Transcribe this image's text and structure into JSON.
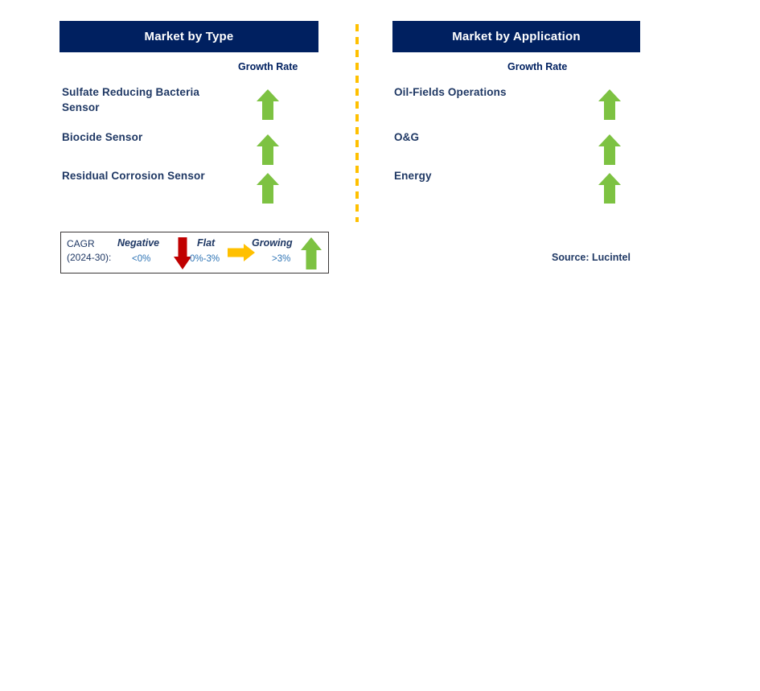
{
  "panels": [
    {
      "id": "market-by-type",
      "title": "Market by Type",
      "growth_rate_label": "Growth Rate",
      "rows": [
        {
          "label": "Sulfate Reducing Bacteria Sensor",
          "growth": "Growing",
          "icon": "arrow-up-green-icon"
        },
        {
          "label": "Biocide Sensor",
          "growth": "Growing",
          "icon": "arrow-up-green-icon"
        },
        {
          "label": "Residual Corrosion Sensor",
          "growth": "Growing",
          "icon": "arrow-up-green-icon"
        }
      ]
    },
    {
      "id": "market-by-application",
      "title": "Market by Application",
      "growth_rate_label": "Growth Rate",
      "rows": [
        {
          "label": "Oil-Fields Operations",
          "growth": "Growing",
          "icon": "arrow-up-green-icon"
        },
        {
          "label": "O&G",
          "growth": "Growing",
          "icon": "arrow-up-green-icon"
        },
        {
          "label": "Energy",
          "growth": "Growing",
          "icon": "arrow-up-green-icon"
        }
      ]
    }
  ],
  "legend": {
    "cagr_line1": "CAGR",
    "cagr_line2": "(2024-30):",
    "items": [
      {
        "term": "Negative",
        "range": "<0%",
        "icon": "arrow-down-red-icon"
      },
      {
        "term": "Flat",
        "range": "0%-3%",
        "icon": "arrow-right-orange-icon"
      },
      {
        "term": "Growing",
        "range": ">3%",
        "icon": "arrow-up-green-icon"
      }
    ]
  },
  "source": "Source: Lucintel",
  "colors": {
    "header_navy": "#002060",
    "label_navy": "#1F3864",
    "growing_green": "#7DC242",
    "negative_red": "#C00000",
    "flat_orange": "#FFC000",
    "divider_orange": "#FFC000",
    "range_blue": "#2E74B5"
  }
}
